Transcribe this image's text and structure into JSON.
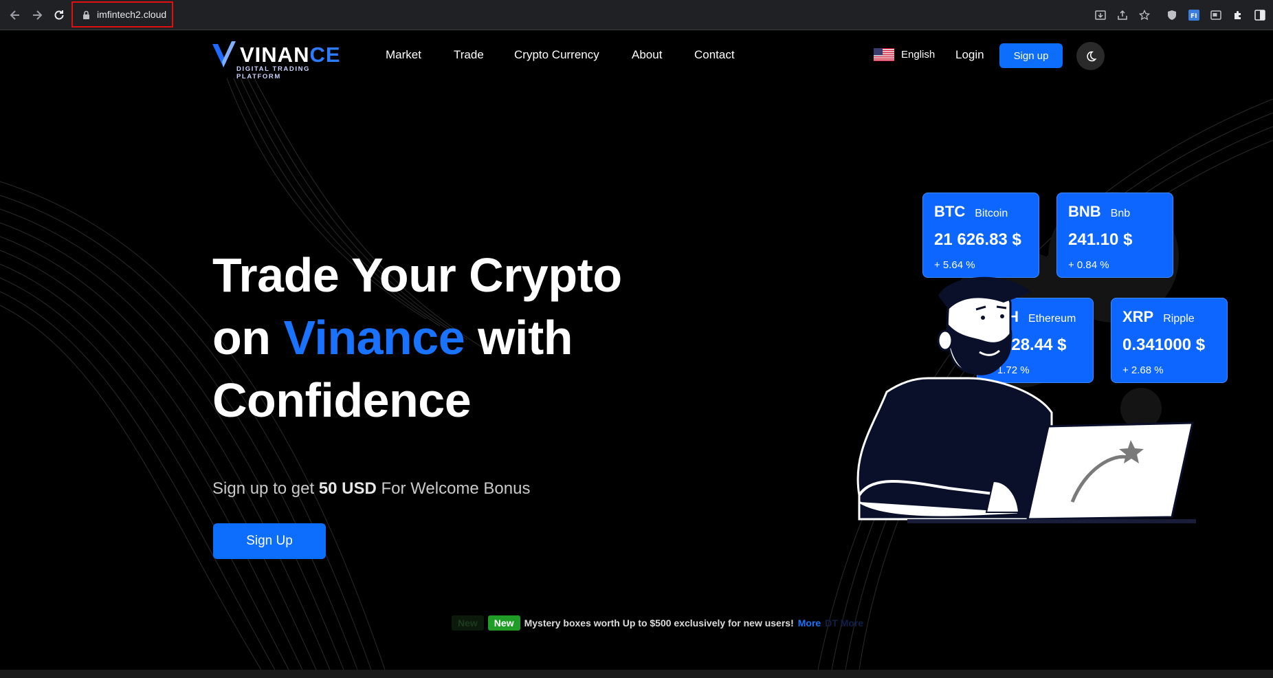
{
  "browser": {
    "url": "imfintech2.cloud"
  },
  "header": {
    "logo_word_white": "VINAN",
    "logo_word_blue": "CE",
    "logo_tagline": "DIGITAL TRADING PLATFORM",
    "nav": [
      "Market",
      "Trade",
      "Crypto Currency",
      "About",
      "Contact"
    ],
    "language": "English",
    "login": "Login",
    "signup": "Sign up"
  },
  "hero": {
    "line1": "Trade Your Crypto",
    "line2_pre": "on ",
    "line2_highlight": "Vinance",
    "line2_post": " with",
    "line3": "Confidence",
    "sub_pre": "Sign up to get ",
    "sub_bold": "50 USD",
    "sub_post": " For Welcome Bonus",
    "cta": "Sign Up"
  },
  "cards": [
    {
      "symbol": "BTC",
      "name": "Bitcoin",
      "price": "21 626.83 $",
      "change": "+ 5.64 %"
    },
    {
      "symbol": "BNB",
      "name": "Bnb",
      "price": "241.10 $",
      "change": "+ 0.84 %"
    },
    {
      "symbol": "ETH",
      "name": "Ethereum",
      "price": "1 228.44 $",
      "change": "+ 1.72 %"
    },
    {
      "symbol": "XRP",
      "name": "Ripple",
      "price": "0.341000 $",
      "change": "+ 2.68 %"
    }
  ],
  "ticker": {
    "ghost_badge": "New",
    "badge": "New",
    "message": "Mystery boxes worth Up to $500 exclusively for new users!",
    "more": "More",
    "trail": "DT More"
  },
  "colors": {
    "accent": "#0d6efd",
    "highlight": "#1a73ff",
    "badge_green": "#1f9d27"
  }
}
